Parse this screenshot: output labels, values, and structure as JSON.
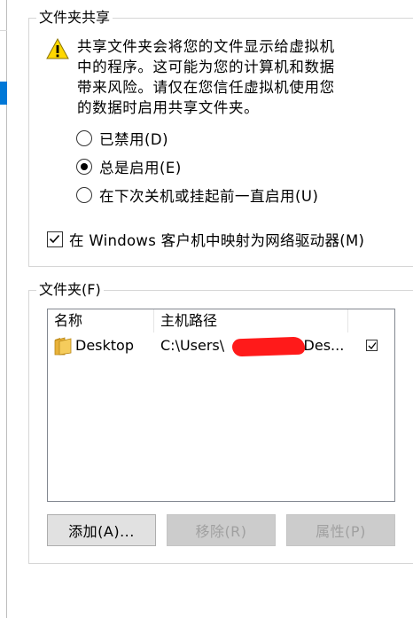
{
  "share_group": {
    "title": "文件夹共享",
    "warning_lines": [
      "共享文件夹会将您的文件显示给虚拟机",
      "中的程序。这可能为您的计算机和数据",
      "带来风险。请仅在您信任虚拟机使用您",
      "的数据时启用共享文件夹。"
    ],
    "options": [
      {
        "label": "已禁用(D)",
        "checked": false
      },
      {
        "label": "总是启用(E)",
        "checked": true
      },
      {
        "label": "在下次关机或挂起前一直启用(U)",
        "checked": false
      }
    ],
    "map_drive": {
      "label": "在 Windows 客户机中映射为网络驱动器(M)",
      "checked": true
    }
  },
  "folder_group": {
    "title": "文件夹(F)",
    "columns": {
      "name": "名称",
      "path": "主机路径"
    },
    "rows": [
      {
        "name": "Desktop",
        "path_start": "C:\\Users\\",
        "path_end": "\\Des...",
        "enabled": true
      }
    ],
    "buttons": {
      "add": "添加(A)...",
      "remove": "移除(R)",
      "properties": "属性(P)"
    }
  },
  "icons": {
    "warning": "warning-icon",
    "folder": "folder-icon"
  },
  "colors": {
    "accent": "#0078d7",
    "warning_fill": "#ffd800",
    "folder": "#e8b23a",
    "redaction": "#ff1a1a"
  }
}
